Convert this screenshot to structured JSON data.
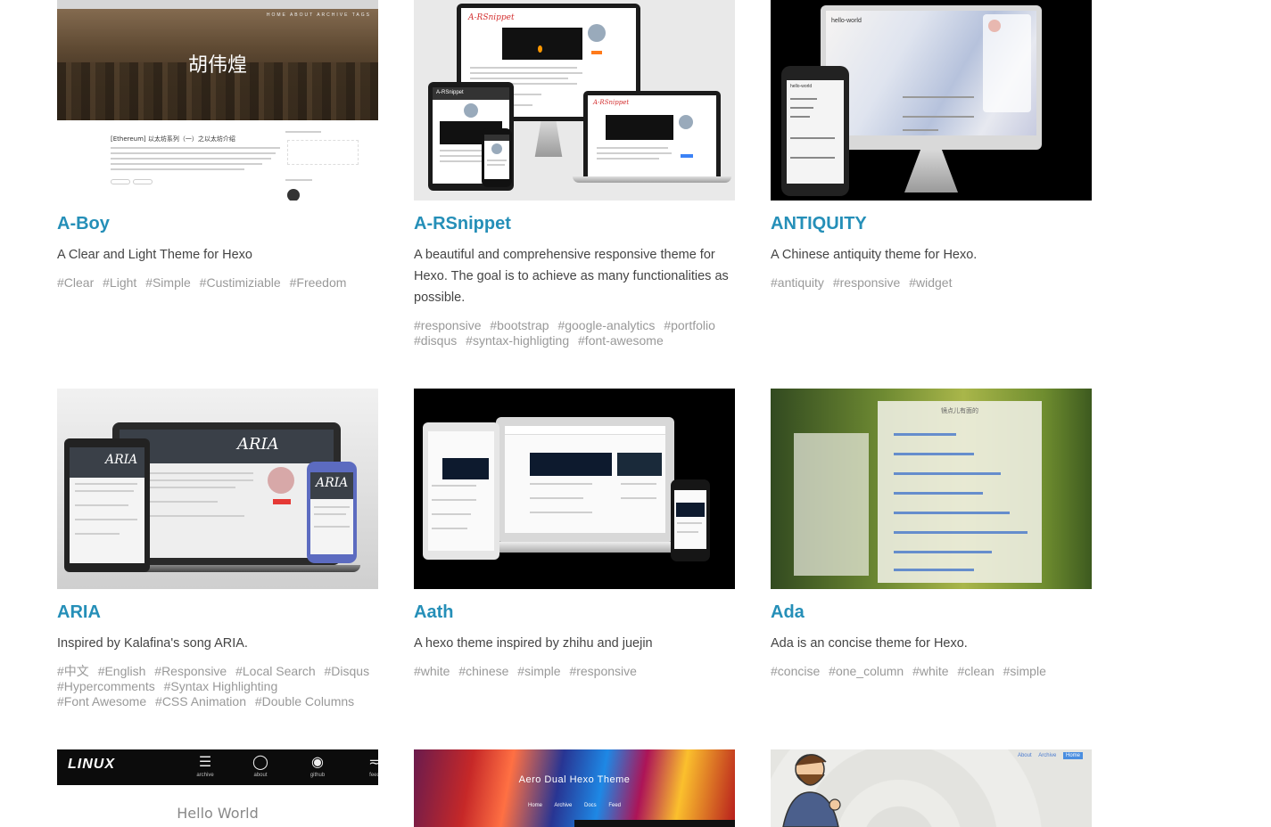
{
  "themes": [
    {
      "name": "A-Boy",
      "description": "A Clear and Light Theme for Hexo",
      "tags": [
        "#Clear",
        "#Light",
        "#Simple",
        "#Custimiziable",
        "#Freedom"
      ],
      "preview": {
        "hero_name": "胡伟煌",
        "nav_text": "HOME ABOUT ARCHIVE TAGS",
        "post_title": "[Ethereum] 以太坊系列（一）之以太坊介绍"
      }
    },
    {
      "name": "A-RSnippet",
      "description": "A beautiful and comprehensive responsive theme for Hexo. The goal is to achieve as many functionalities as possible.",
      "tags": [
        "#responsive",
        "#bootstrap",
        "#google-analytics",
        "#portfolio",
        "#disqus",
        "#syntax-highligting",
        "#font-awesome"
      ],
      "preview": {
        "logo": "A-RSnippet"
      }
    },
    {
      "name": "ANTIQUITY",
      "description": "A Chinese antiquity theme for Hexo.",
      "tags": [
        "#antiquity",
        "#responsive",
        "#widget"
      ],
      "preview": {
        "post_title": "hello-world"
      }
    },
    {
      "name": "ARIA",
      "description": "Inspired by Kalafina's song ARIA.",
      "tags": [
        "#中文",
        "#English",
        "#Responsive",
        "#Local Search",
        "#Disqus",
        "#Hypercomments",
        "#Syntax Highlighting",
        "#Font Awesome",
        "#CSS Animation",
        "#Double Columns"
      ],
      "preview": {
        "logo": "ARIA"
      }
    },
    {
      "name": "Aath",
      "description": "A hexo theme inspired by zhihu and juejin",
      "tags": [
        "#white",
        "#chinese",
        "#simple",
        "#responsive"
      ],
      "preview": {}
    },
    {
      "name": "Ada",
      "description": "Ada is an concise theme for Hexo.",
      "tags": [
        "#concise",
        "#one_column",
        "#white",
        "#clean",
        "#simple"
      ],
      "preview": {
        "heading": "镜点儿有面的"
      }
    },
    {
      "name": "",
      "description": "",
      "tags": [],
      "preview": {
        "logo": "LINUX",
        "nav": [
          "archive",
          "about",
          "github",
          "feed"
        ],
        "hello": "Hello World"
      }
    },
    {
      "name": "",
      "description": "",
      "tags": [],
      "preview": {
        "title": "Aero Dual Hexo Theme",
        "links": "Home Archive Docs Feed"
      }
    },
    {
      "name": "",
      "description": "",
      "tags": [],
      "preview": {
        "nav": [
          "About",
          "Archive",
          "Home"
        ]
      }
    }
  ],
  "colors": {
    "title_link": "#258fb8",
    "description": "#444444",
    "tag": "#999999"
  },
  "icons": {
    "archive": "document-icon",
    "about": "apple-icon",
    "github": "github-icon",
    "feed": "rss-icon"
  }
}
